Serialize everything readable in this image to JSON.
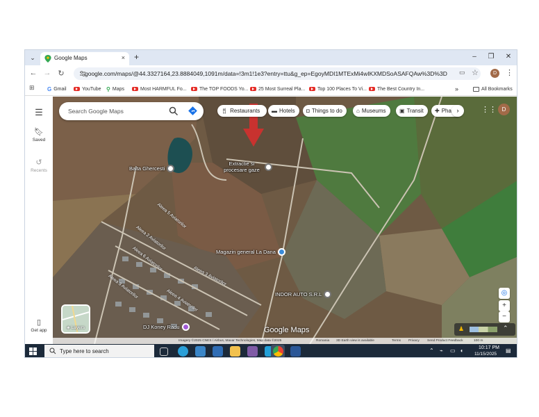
{
  "browser": {
    "tab_title": "Google Maps",
    "tab_close": "×",
    "new_tab": "+",
    "window_controls": {
      "minimize": "–",
      "restore": "❐",
      "close": "✕"
    },
    "url": "google.com/maps/@44.3327164,23.8884049,1091m/data=!3m1!1e3?entry=ttu&g_ep=EgoyMDI1MTExMi4wIKXMDSoASAFQAw%3D%3D",
    "profile_initial": "D",
    "bookmarks": [
      {
        "label": "Gmail",
        "icon": "gmail-icon"
      },
      {
        "label": "YouTube",
        "icon": "youtube-icon"
      },
      {
        "label": "Maps",
        "icon": "maps-icon"
      },
      {
        "label": "Most HARMFUL Fo...",
        "icon": "youtube-icon"
      },
      {
        "label": "The TOP FOODS Yo...",
        "icon": "youtube-icon"
      },
      {
        "label": "25 Most Surreal Pla...",
        "icon": "youtube-icon"
      },
      {
        "label": "Top 100 Places To Vi...",
        "icon": "youtube-icon"
      },
      {
        "label": "The Best Country In...",
        "icon": "youtube-icon"
      }
    ],
    "bookmarks_overflow": "»",
    "all_bookmarks": "All Bookmarks"
  },
  "maps": {
    "rail": {
      "saved": "Saved",
      "recents": "Recents",
      "get_app": "Get app"
    },
    "search_placeholder": "Search Google Maps",
    "chips": [
      "Restaurants",
      "Hotels",
      "Things to do",
      "Museums",
      "Transit",
      "Pharmacies"
    ],
    "chip_next": "›",
    "avatar": "D",
    "places": {
      "lake": "Balta Ghercesti",
      "gas": "Extractie si procesare gaze",
      "store": "Magazin general La Dana",
      "auto": "INDOR AUTO S.R.L",
      "dj": "DJ Koney Radu"
    },
    "streets": [
      "Aleea 5 Aviatorilor",
      "Aleea 2 Aviatorilor",
      "Aleea 6 Aviatorilor",
      "Aleea 3 Aviatorilor",
      "Aleea 4 Aviatorilor",
      "Aleea 3 Aviatorilor"
    ],
    "layers_label": "Layers",
    "logo": "Google Maps",
    "attribution": {
      "imagery": "Imagery ©2025 CNES / Airbus, Maxar Technologies, Map data ©2025",
      "country": "Romania",
      "earth": "3D Earth view is available",
      "terms": "Terms",
      "privacy": "Privacy",
      "feedback": "Send Product Feedback",
      "scale": "100 m"
    },
    "zoom_in": "+",
    "zoom_out": "−",
    "expand": "⌃"
  },
  "taskbar": {
    "search_placeholder": "Type here to search",
    "time": "10:17 PM",
    "date": "11/15/2025"
  }
}
